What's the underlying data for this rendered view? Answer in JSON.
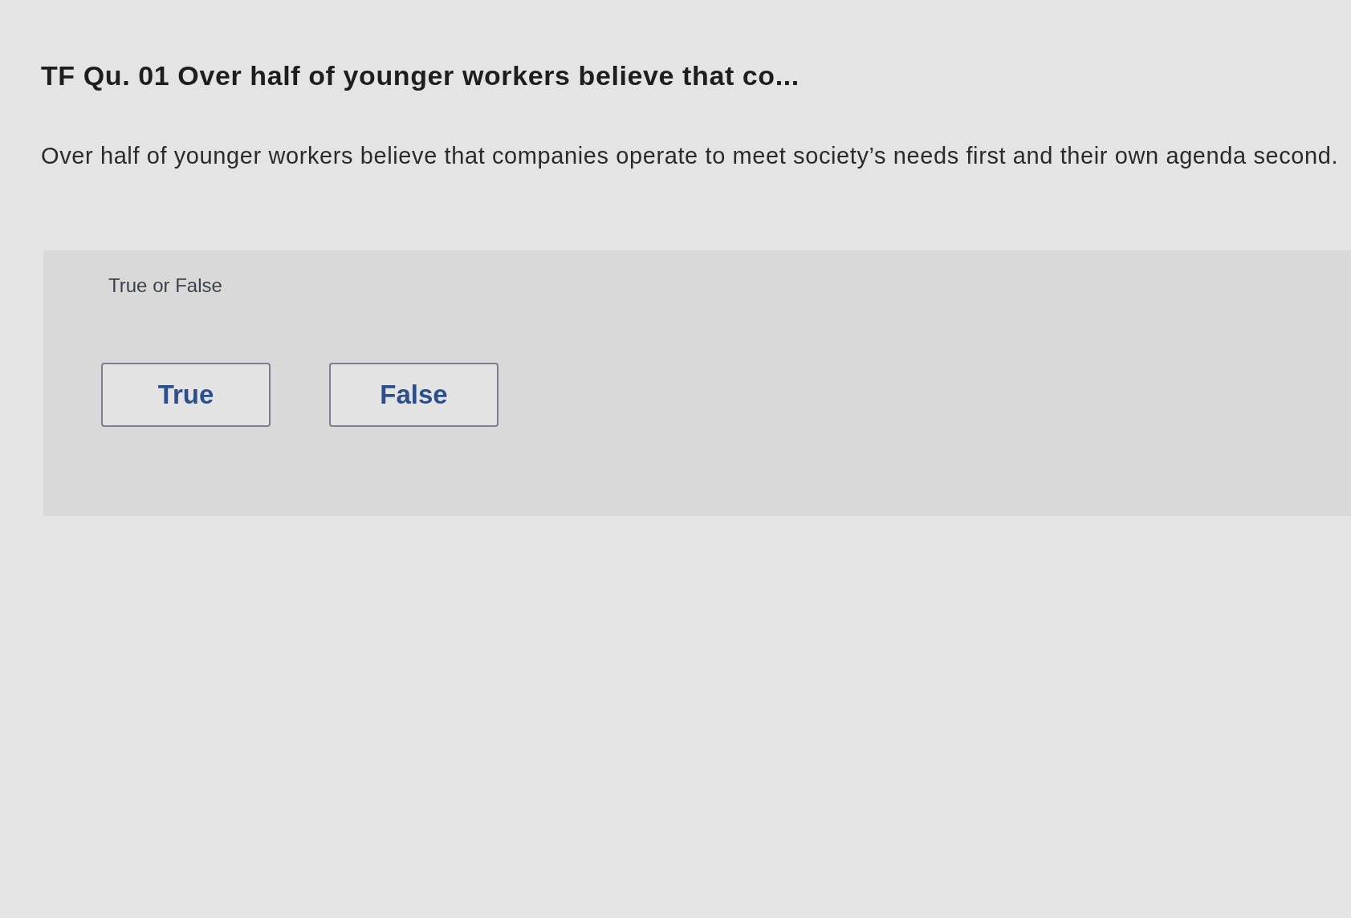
{
  "title": "TF Qu. 01 Over half of younger workers believe that co...",
  "question": "Over half of younger workers believe that companies operate to meet society’s needs first and their own agenda second.",
  "answer_panel": {
    "label": "True or False",
    "buttons": [
      {
        "label": "True"
      },
      {
        "label": "False"
      }
    ]
  }
}
